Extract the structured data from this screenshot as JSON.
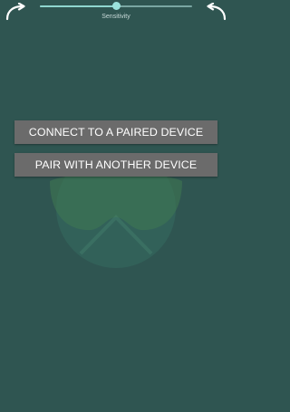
{
  "slider": {
    "label": "Sensitivity",
    "value_fraction": 0.5
  },
  "icons": {
    "left": "curved-arrow-back-icon",
    "right": "curved-arrow-forward-icon"
  },
  "buttons": {
    "connect_label": "CONNECT TO A PAIRED DEVICE",
    "pair_label": "PAIR WITH ANOTHER DEVICE"
  },
  "colors": {
    "background": "#2f5551",
    "button": "#6b6b6b",
    "slider_accent": "#9be3dc"
  }
}
